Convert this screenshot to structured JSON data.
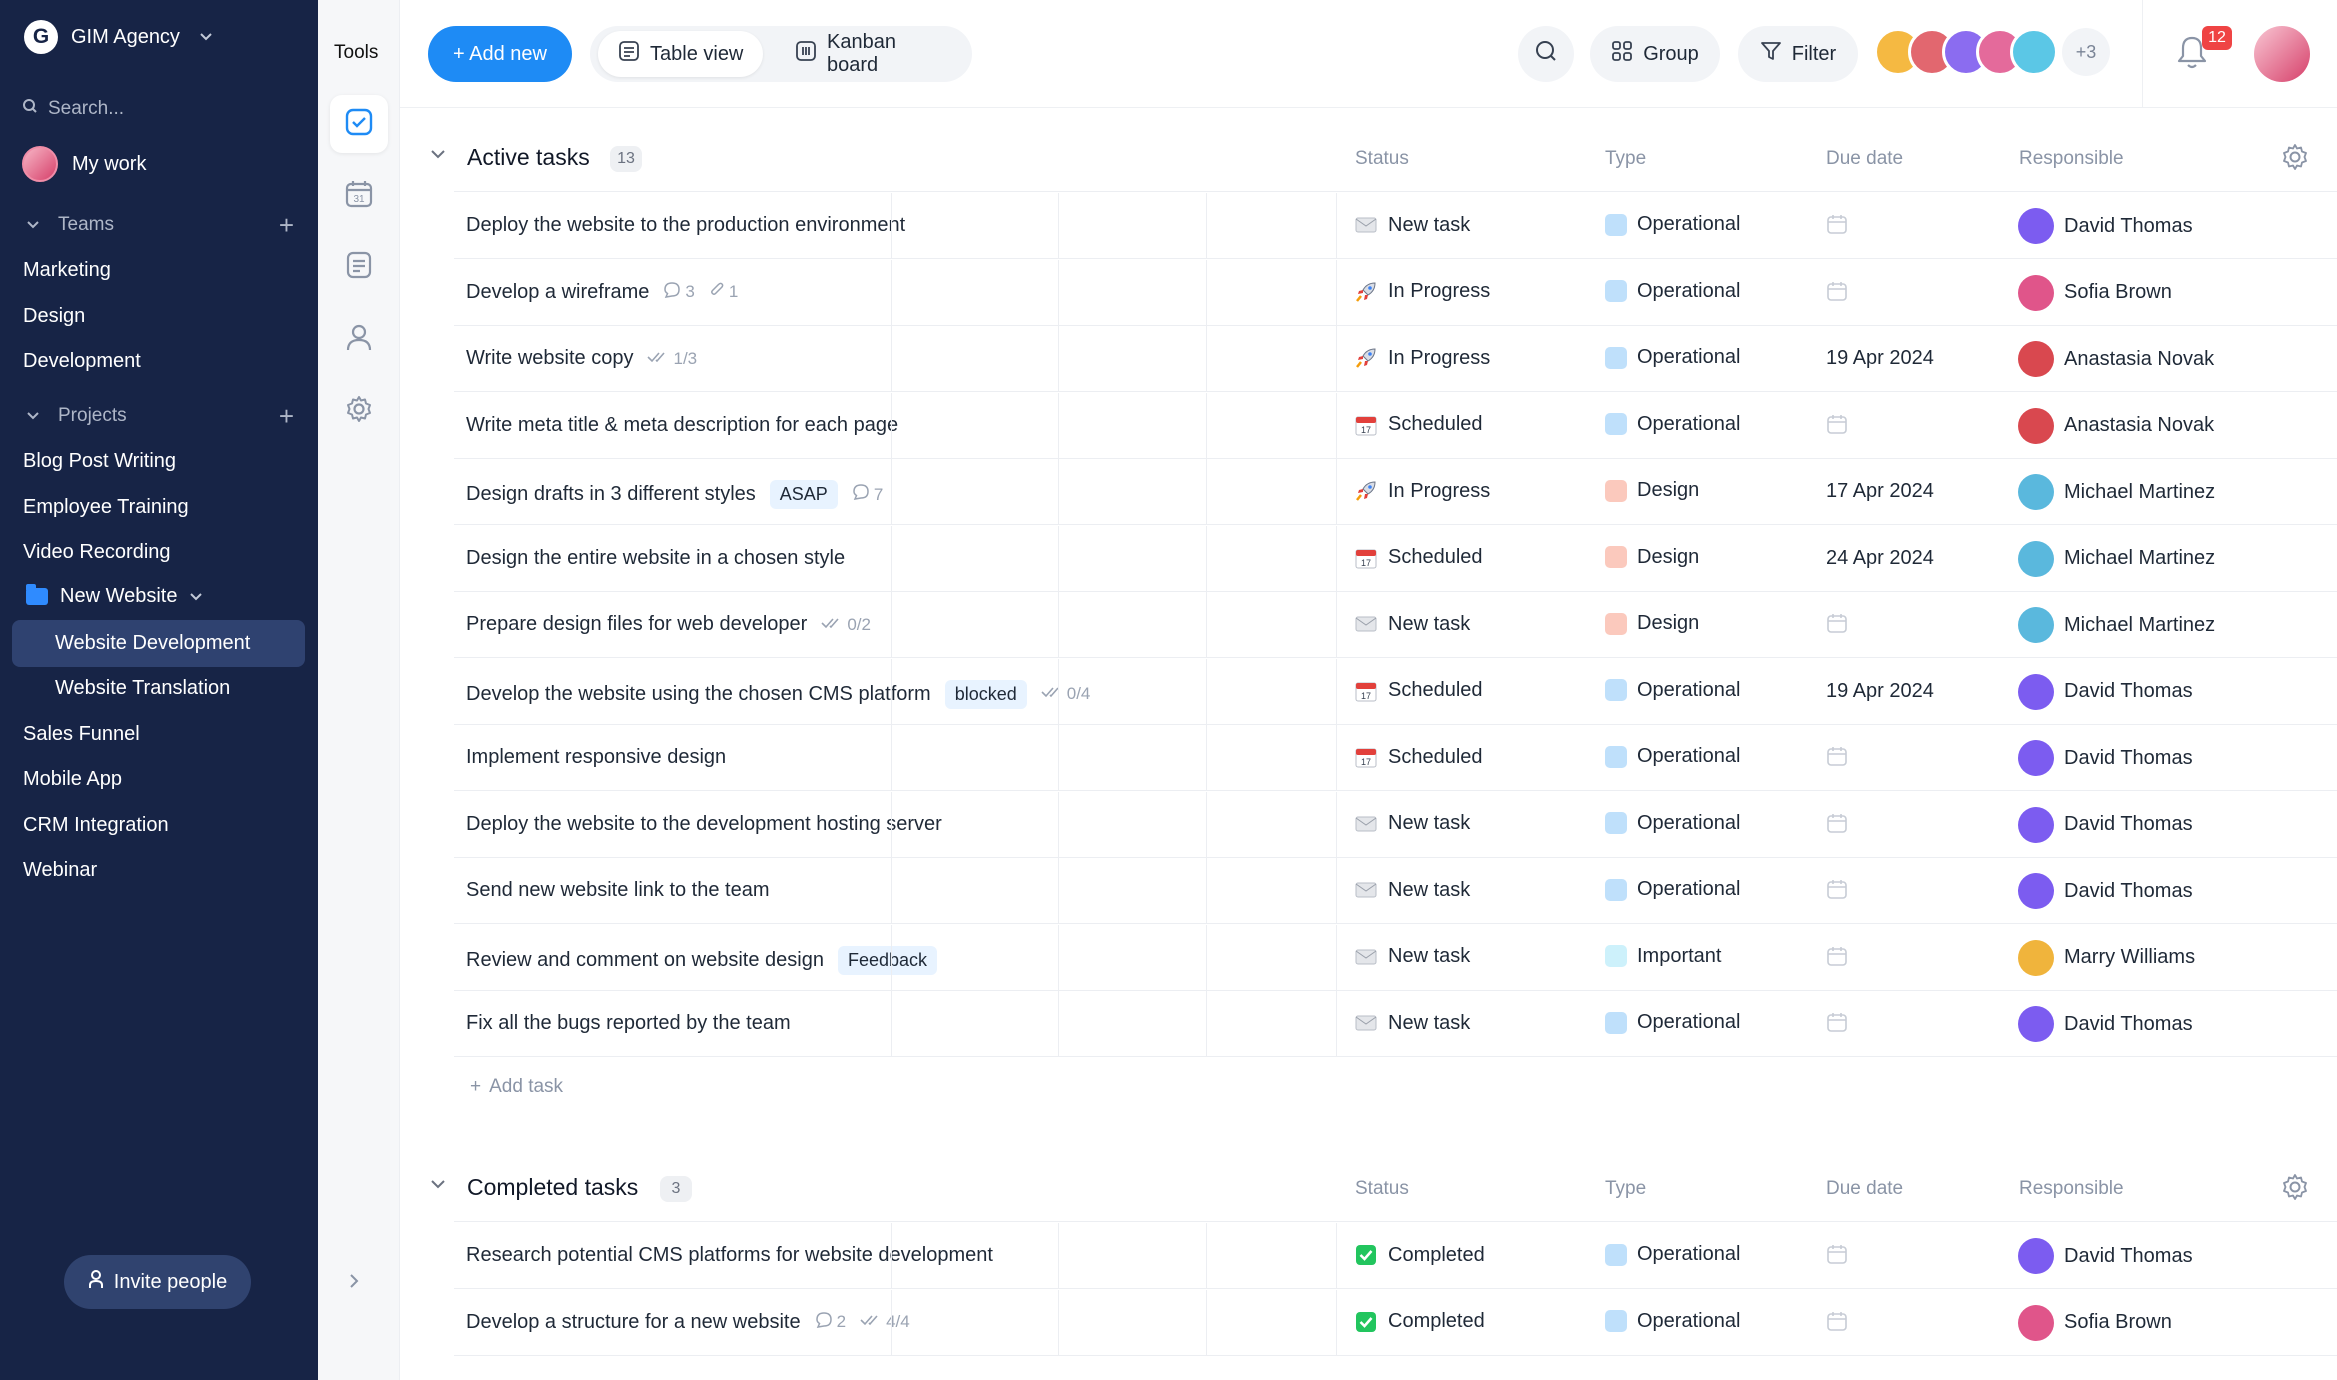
{
  "workspace": {
    "name": "GIM Agency",
    "logo_letter": "G"
  },
  "sidebar": {
    "search_placeholder": "Search...",
    "my_work": "My work",
    "teams_label": "Teams",
    "teams": [
      "Marketing",
      "Design",
      "Development"
    ],
    "projects_label": "Projects",
    "projects": [
      "Blog Post Writing",
      "Employee Training",
      "Video Recording"
    ],
    "folder": "New Website",
    "folder_items": [
      "Website Development",
      "Website Translation"
    ],
    "projects_after": [
      "Sales Funnel",
      "Mobile App",
      "CRM Integration",
      "Webinar"
    ],
    "invite": "Invite people"
  },
  "tools": {
    "title": "Tools"
  },
  "toolbar": {
    "add_new": "+ Add new",
    "table_view": "Table view",
    "kanban": "Kanban board",
    "group": "Group",
    "filter": "Filter",
    "more_members": "+3",
    "notifications": "12"
  },
  "colors": {
    "accent": "#1e8bf5",
    "sidebar": "#172446",
    "operational": "#bfe0fb",
    "design": "#fbc9bd",
    "important": "#cdf1fb"
  },
  "columns": {
    "status": "Status",
    "type": "Type",
    "due": "Due date",
    "responsible": "Responsible"
  },
  "active": {
    "title": "Active tasks",
    "count": "13",
    "tasks": [
      {
        "name": "Deploy the website to the production environment",
        "status": "New task",
        "status_icon": "envelope-icon",
        "type": "Operational",
        "due": "",
        "responsible": "David Thomas"
      },
      {
        "name": "Develop a wireframe",
        "comments": "3",
        "attachments": "1",
        "status": "In Progress",
        "status_icon": "rocket-icon",
        "type": "Operational",
        "due": "",
        "responsible": "Sofia Brown"
      },
      {
        "name": "Write website copy",
        "checklist": "1/3",
        "status": "In Progress",
        "status_icon": "rocket-icon",
        "type": "Operational",
        "due": "19 Apr 2024",
        "responsible": "Anastasia Novak"
      },
      {
        "name": "Write meta title & meta description for each page",
        "status": "Scheduled",
        "status_icon": "calendar-icon",
        "type": "Operational",
        "due": "",
        "responsible": "Anastasia Novak"
      },
      {
        "name": "Design drafts in 3 different styles",
        "tag": "ASAP",
        "comments": "7",
        "status": "In Progress",
        "status_icon": "rocket-icon",
        "type": "Design",
        "due": "17 Apr 2024",
        "responsible": "Michael Martinez"
      },
      {
        "name": "Design the entire website in a chosen style",
        "status": "Scheduled",
        "status_icon": "calendar-icon",
        "type": "Design",
        "due": "24 Apr 2024",
        "responsible": "Michael Martinez"
      },
      {
        "name": "Prepare design files for web developer",
        "checklist": "0/2",
        "status": "New task",
        "status_icon": "envelope-icon",
        "type": "Design",
        "due": "",
        "responsible": "Michael Martinez"
      },
      {
        "name": "Develop the website using the chosen CMS platform",
        "tag": "blocked",
        "checklist": "0/4",
        "status": "Scheduled",
        "status_icon": "calendar-icon",
        "type": "Operational",
        "due": "19 Apr 2024",
        "responsible": "David Thomas"
      },
      {
        "name": "Implement responsive design",
        "status": "Scheduled",
        "status_icon": "calendar-icon",
        "type": "Operational",
        "due": "",
        "responsible": "David Thomas"
      },
      {
        "name": "Deploy the website to the development hosting server",
        "status": "New task",
        "status_icon": "envelope-icon",
        "type": "Operational",
        "due": "",
        "responsible": "David Thomas"
      },
      {
        "name": "Send new website link to the team",
        "status": "New task",
        "status_icon": "envelope-icon",
        "type": "Operational",
        "due": "",
        "responsible": "David Thomas"
      },
      {
        "name": "Review and comment on website design",
        "tag": "Feedback",
        "status": "New task",
        "status_icon": "envelope-icon",
        "type": "Important",
        "due": "",
        "responsible": "Marry Williams"
      },
      {
        "name": "Fix all the bugs reported by the team",
        "status": "New task",
        "status_icon": "envelope-icon",
        "type": "Operational",
        "due": "",
        "responsible": "David Thomas"
      }
    ],
    "add_task": "Add task"
  },
  "completed": {
    "title": "Completed tasks",
    "count": "3",
    "tasks": [
      {
        "name": "Research potential CMS platforms for website development",
        "status": "Completed",
        "status_icon": "check-icon",
        "type": "Operational",
        "due": "",
        "responsible": "David Thomas"
      },
      {
        "name": "Develop a structure for a new website",
        "checklist": "4/4",
        "comments": "2",
        "status": "Completed",
        "status_icon": "check-icon",
        "type": "Operational",
        "due": "",
        "responsible": "Sofia Brown"
      }
    ]
  }
}
